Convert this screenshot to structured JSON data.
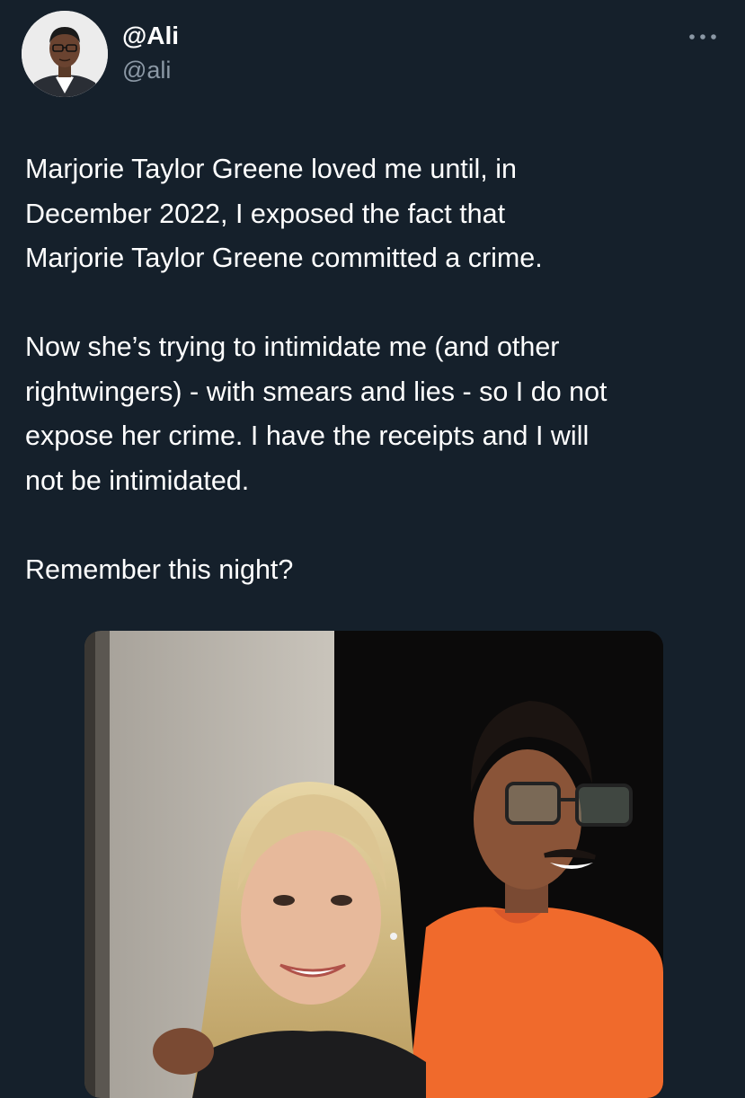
{
  "tweet": {
    "display_name": "@Ali",
    "handle": "@ali",
    "avatar_icon": "user-avatar-photo",
    "more_icon": "more-horizontal-icon",
    "paragraphs": [
      {
        "lines": [
          "Marjorie Taylor Greene loved me until, in",
          "December 2022, I exposed the fact that",
          "Marjorie Taylor Greene committed a crime."
        ]
      },
      {
        "lines": [
          "Now she’s trying to intimidate me (and other",
          "rightwingers) - with smears and lies - so I do not",
          "expose her crime. I have the receipts and I will",
          "not be intimidated."
        ]
      },
      {
        "lines": [
          "Remember this night?"
        ]
      }
    ],
    "media": {
      "type": "photo",
      "description_icon": "photo-two-people"
    }
  },
  "colors": {
    "background": "#15202b",
    "text_primary": "#ffffff",
    "text_secondary": "#8b98a5",
    "orange_shirt": "#f06a2c"
  }
}
